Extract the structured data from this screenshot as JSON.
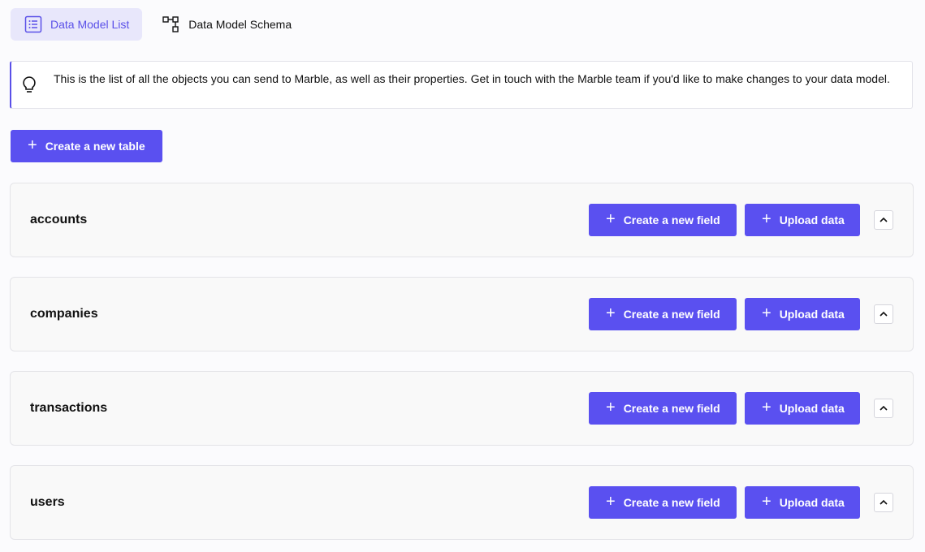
{
  "tabs": [
    {
      "label": "Data Model List",
      "icon": "list-icon",
      "active": true
    },
    {
      "label": "Data Model Schema",
      "icon": "schema-icon",
      "active": false
    }
  ],
  "callout": {
    "icon": "lightbulb-icon",
    "text": "This is the list of all the objects you can send to Marble, as well as their properties. Get in touch with the Marble team if you'd like to make changes to your data model."
  },
  "create_table_label": "Create a new table",
  "tables": [
    {
      "name": "accounts",
      "create_field_label": "Create a new field",
      "upload_label": "Upload data"
    },
    {
      "name": "companies",
      "create_field_label": "Create a new field",
      "upload_label": "Upload data"
    },
    {
      "name": "transactions",
      "create_field_label": "Create a new field",
      "upload_label": "Upload data"
    },
    {
      "name": "users",
      "create_field_label": "Create a new field",
      "upload_label": "Upload data"
    }
  ],
  "colors": {
    "accent": "#5a50f0",
    "active_tab_bg": "#e8e7fb"
  }
}
